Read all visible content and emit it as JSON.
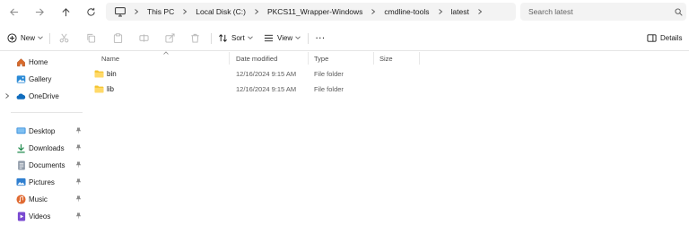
{
  "address_bar": {
    "breadcrumbs": [
      "This PC",
      "Local Disk (C:)",
      "PKCS11_Wrapper-Windows",
      "cmdline-tools",
      "latest"
    ]
  },
  "search": {
    "placeholder": "Search latest"
  },
  "toolbar": {
    "new_label": "New",
    "sort_label": "Sort",
    "view_label": "View",
    "more_label": "···",
    "details_label": "Details"
  },
  "nav_pane": {
    "items": [
      {
        "label": "Home",
        "icon": "home-icon"
      },
      {
        "label": "Gallery",
        "icon": "gallery-icon"
      },
      {
        "label": "OneDrive",
        "icon": "onedrive-icon"
      },
      {
        "label": "Desktop",
        "icon": "desktop-icon"
      },
      {
        "label": "Downloads",
        "icon": "downloads-icon"
      },
      {
        "label": "Documents",
        "icon": "documents-icon"
      },
      {
        "label": "Pictures",
        "icon": "pictures-icon"
      },
      {
        "label": "Music",
        "icon": "music-icon"
      },
      {
        "label": "Videos",
        "icon": "videos-icon"
      }
    ]
  },
  "file_list": {
    "columns": [
      "Name",
      "Date modified",
      "Type",
      "Size"
    ],
    "rows": [
      {
        "name": "bin",
        "date_modified": "12/16/2024 9:15 AM",
        "type": "File folder",
        "size": ""
      },
      {
        "name": "lib",
        "date_modified": "12/16/2024 9:15 AM",
        "type": "File folder",
        "size": ""
      }
    ]
  },
  "colors": {
    "folder": "#f4c430",
    "accent": "#0067c0",
    "home": "#d86a2b"
  }
}
